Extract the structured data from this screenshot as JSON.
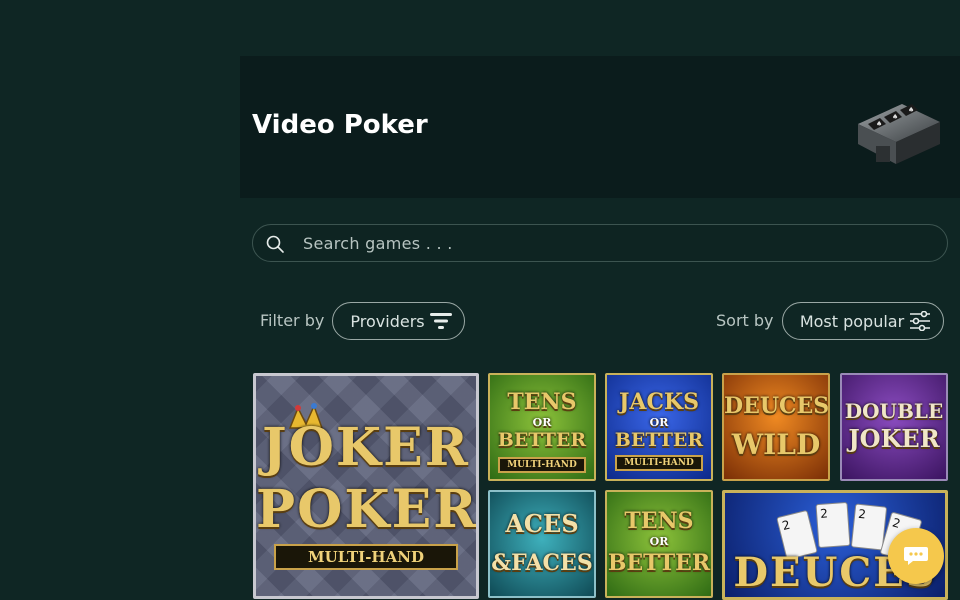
{
  "hero": {
    "title": "Video Poker",
    "icon": "video-poker-machine-icon"
  },
  "search": {
    "placeholder": "Search games . . .",
    "icon": "search-icon"
  },
  "filter": {
    "label": "Filter by",
    "button_label": "Providers",
    "icon": "filter-funnel-icon"
  },
  "sort": {
    "label": "Sort by",
    "button_label": "Most popular",
    "icon": "sliders-icon"
  },
  "games": [
    {
      "name": "Joker Poker Multi-Hand",
      "line1": "JOKER",
      "line2": "POKER",
      "sub": "MULTI-HAND"
    },
    {
      "name": "Tens or Better Multi-Hand",
      "line1": "TENS",
      "line2": "BETTER",
      "mid": "OR",
      "sub": "MULTI-HAND"
    },
    {
      "name": "Jacks or Better Multi-Hand",
      "line1": "JACKS",
      "line2": "BETTER",
      "mid": "OR",
      "sub": "MULTI-HAND"
    },
    {
      "name": "Deuces Wild",
      "line1": "DEUCES",
      "line2": "WILD"
    },
    {
      "name": "Double Joker",
      "line1": "DOUBLE",
      "line2": "JOKER"
    },
    {
      "name": "Aces & Faces",
      "line1": "ACES",
      "line2": "&FACES"
    },
    {
      "name": "Tens or Better",
      "line1": "TENS",
      "line2": "BETTER",
      "mid": "OR"
    },
    {
      "name": "Deuces",
      "line1": "DEUCES",
      "cards": [
        "2",
        "2",
        "2",
        "2"
      ]
    }
  ],
  "chat": {
    "icon": "chat-bubble-icon"
  },
  "colors": {
    "background": "#0f2624",
    "hero": "#0b1c1c",
    "accent": "#f5c84c",
    "pill_border": "#9aa8a5"
  }
}
